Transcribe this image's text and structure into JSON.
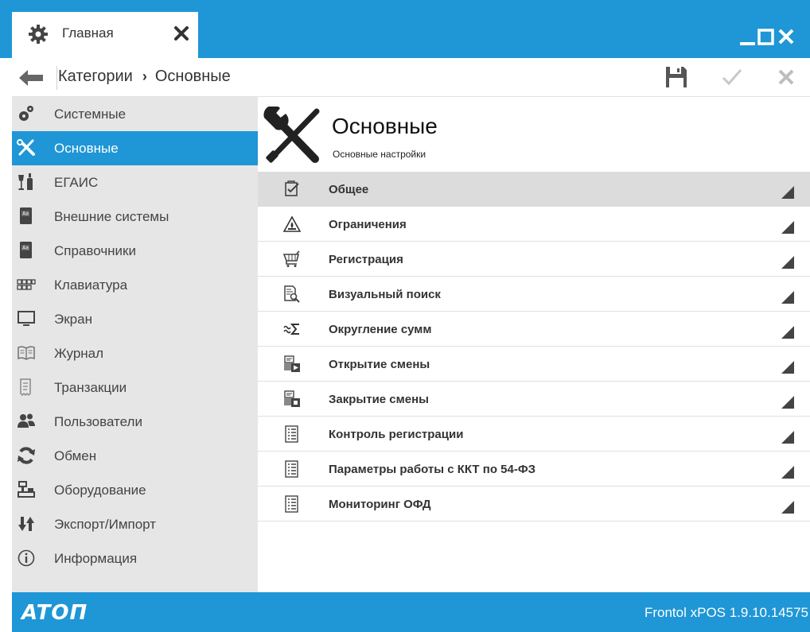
{
  "window": {
    "tab_title": "Главная",
    "tab_icon": "gear-icon",
    "controls": [
      "minimize-icon",
      "maximize-icon",
      "close-icon"
    ]
  },
  "toolbar": {
    "breadcrumb": [
      "Категории",
      "Основные"
    ],
    "actions": [
      "save-icon",
      "confirm-icon",
      "cancel-icon"
    ]
  },
  "sidebar": {
    "items": [
      {
        "label": "Системные",
        "icon": "gears-icon"
      },
      {
        "label": "Основные",
        "icon": "tools-icon",
        "active": true
      },
      {
        "label": "ЕГАИС",
        "icon": "bottle-glass-icon"
      },
      {
        "label": "Внешние системы",
        "icon": "book-icon"
      },
      {
        "label": "Справочники",
        "icon": "book-icon"
      },
      {
        "label": "Клавиатура",
        "icon": "keyboard-icon"
      },
      {
        "label": "Экран",
        "icon": "monitor-icon"
      },
      {
        "label": "Журнал",
        "icon": "open-book-icon"
      },
      {
        "label": "Транзакции",
        "icon": "receipt-icon"
      },
      {
        "label": "Пользователи",
        "icon": "users-icon"
      },
      {
        "label": "Обмен",
        "icon": "sync-icon"
      },
      {
        "label": "Оборудование",
        "icon": "pos-terminal-icon"
      },
      {
        "label": "Экспорт/Импорт",
        "icon": "arrows-up-down-icon"
      },
      {
        "label": "Информация",
        "icon": "info-icon"
      }
    ]
  },
  "main": {
    "title": "Основные",
    "subtitle": "Основные настройки",
    "header_icon": "tools-icon",
    "rows": [
      {
        "label": "Общее",
        "icon": "checklist-icon",
        "selected": true
      },
      {
        "label": "Ограничения",
        "icon": "warning-triangle-icon"
      },
      {
        "label": "Регистрация",
        "icon": "shopping-cart-icon"
      },
      {
        "label": "Визуальный поиск",
        "icon": "document-search-icon"
      },
      {
        "label": "Округление сумм",
        "icon": "approx-sum-icon"
      },
      {
        "label": "Открытие смены",
        "icon": "register-open-icon"
      },
      {
        "label": "Закрытие смены",
        "icon": "register-close-icon"
      },
      {
        "label": "Контроль регистрации",
        "icon": "list-icon"
      },
      {
        "label": "Параметры работы с ККТ по 54-ФЗ",
        "icon": "list-icon"
      },
      {
        "label": "Мониторинг ОФД",
        "icon": "list-icon"
      }
    ]
  },
  "statusbar": {
    "logo": "ATOΠ",
    "version": "Frontol xPOS 1.9.10.14575"
  },
  "colors": {
    "accent": "#1f96d6",
    "sidebar_bg": "#e6e6e6",
    "row_selected_bg": "#dcdcdc"
  }
}
